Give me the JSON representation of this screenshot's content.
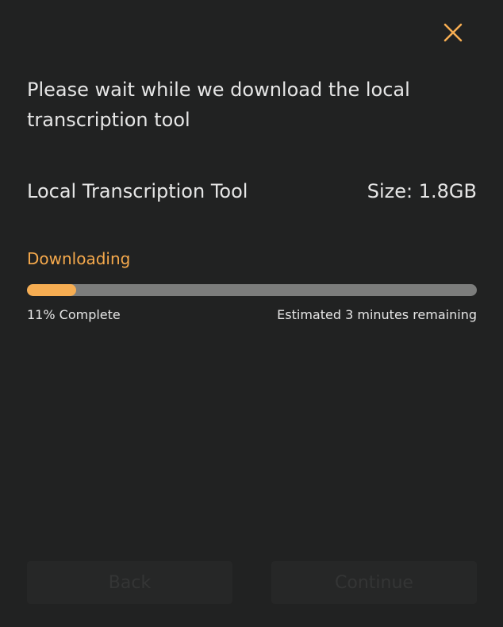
{
  "dialog": {
    "close_icon": "close-x-icon",
    "heading": "Please wait while we download the local transcription tool",
    "tool_name": "Local Transcription Tool",
    "tool_size": "Size: 1.8GB",
    "status": "Downloading",
    "progress_fraction": 0.11,
    "progress_label": "11% Complete",
    "eta_label": "Estimated 3 minutes remaining",
    "back_label": "Back",
    "continue_label": "Continue"
  },
  "colors": {
    "background": "#212222",
    "accent": "#f6ad52",
    "status_text": "#f5a94c",
    "track": "#7c7d7c",
    "text": "#e6e6e6",
    "disabled_button_bg": "#262727",
    "disabled_button_text": "#343535"
  }
}
